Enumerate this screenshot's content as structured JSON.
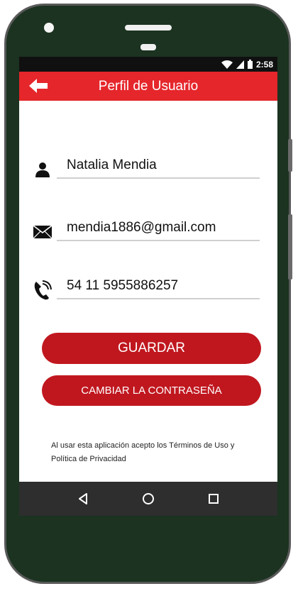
{
  "status_bar": {
    "time": "2:58"
  },
  "app_bar": {
    "title": "Perfil de Usuario"
  },
  "fields": {
    "name": "Natalia Mendia",
    "email": "mendia1886@gmail.com",
    "phone": "54 11 5955886257"
  },
  "buttons": {
    "save": "GUARDAR",
    "change_password": "CAMBIAR LA CONTRASEÑA"
  },
  "terms_text": "Al usar esta aplicación acepto los Términos de Uso y Política de Privacidad",
  "colors": {
    "app_bar": "#e5262b",
    "button": "#c0171f",
    "phone_body": "#1b3320",
    "nav_bar": "#2e2e2e"
  },
  "icons": {
    "back": "arrow-left-icon",
    "name": "person-icon",
    "email": "envelope-icon",
    "phone": "phone-icon",
    "nav_back": "triangle-back-icon",
    "nav_home": "circle-home-icon",
    "nav_recents": "square-recents-icon"
  }
}
